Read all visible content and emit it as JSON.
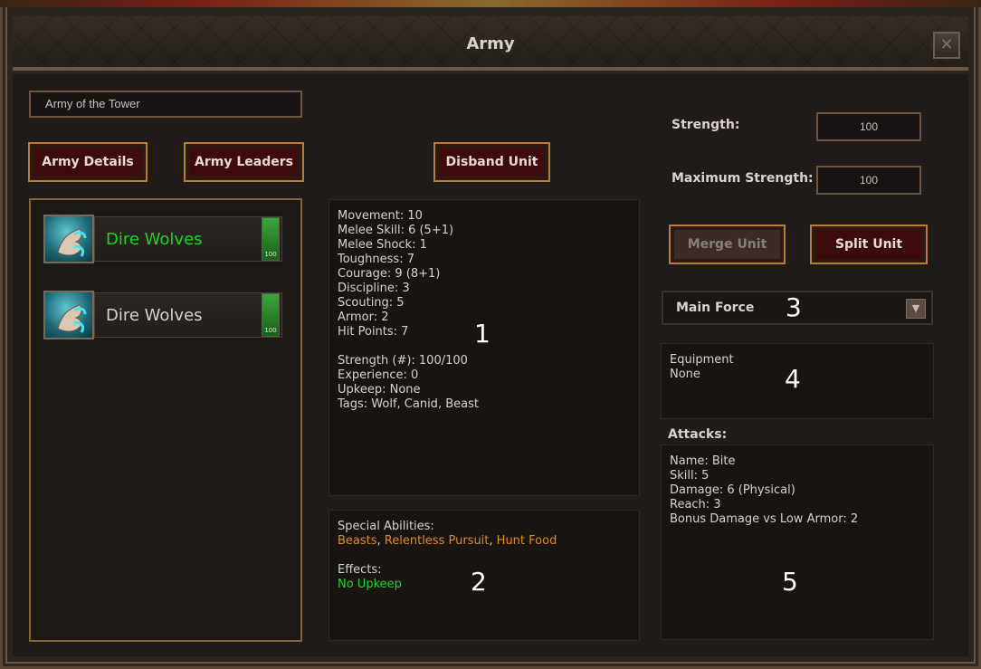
{
  "window": {
    "title": "Army",
    "close_icon": "close-icon"
  },
  "army_name": "Army of the Tower",
  "buttons": {
    "army_details": "Army Details",
    "army_leaders": "Army Leaders",
    "disband_unit": "Disband Unit",
    "merge_unit": "Merge Unit",
    "split_unit": "Split Unit"
  },
  "units": [
    {
      "name": "Dire Wolves",
      "strength": "100",
      "selected": true,
      "name_color": "#2ed12e"
    },
    {
      "name": "Dire Wolves",
      "strength": "100",
      "selected": false,
      "name_color": "#d8d2c8"
    }
  ],
  "stats": {
    "lines": [
      "Movement: 10",
      "Melee Skill: 6 (5+1)",
      "Melee Shock: 1",
      "Toughness: 7",
      "Courage: 9 (8+1)",
      "Discipline: 3",
      "Scouting: 5",
      "Armor: 2",
      "Hit Points: 7",
      "",
      "Strength (#): 100/100",
      "Experience: 0",
      "Upkeep: None",
      "Tags: Wolf, Canid, Beast"
    ],
    "marker": "1"
  },
  "abilities": {
    "heading": "Special Abilities:",
    "items": [
      "Beasts",
      "Relentless Pursuit",
      "Hunt Food"
    ],
    "effects_heading": "Effects:",
    "effects": "No Upkeep",
    "marker": "2"
  },
  "strength_panel": {
    "strength_label": "Strength:",
    "strength_value": "100",
    "max_label": "Maximum Strength:",
    "max_value": "100"
  },
  "group": {
    "selected": "Main Force",
    "marker": "3"
  },
  "equipment": {
    "heading": "Equipment",
    "value": "None",
    "marker": "4"
  },
  "attacks": {
    "heading": "Attacks:",
    "lines": [
      "Name: Bite",
      "Skill: 5",
      "Damage: 6 (Physical)",
      "Reach: 3",
      "Bonus Damage vs Low Armor: 2"
    ],
    "marker": "5"
  },
  "colors": {
    "accent_border": "#b77d3c",
    "button_bg": "#3d0b0b",
    "ability": "#e08a20",
    "effect": "#20d420"
  }
}
